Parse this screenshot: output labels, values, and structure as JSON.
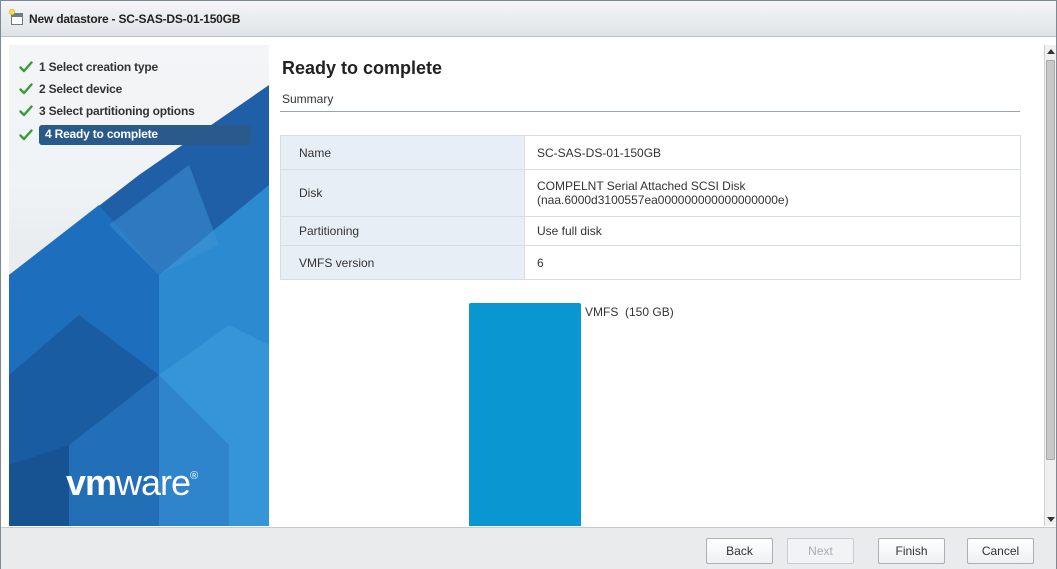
{
  "window": {
    "title": "New datastore - SC-SAS-DS-01-150GB"
  },
  "sidebar": {
    "steps": [
      {
        "label": "1 Select creation type",
        "state": "completed"
      },
      {
        "label": "2 Select device",
        "state": "completed"
      },
      {
        "label": "3 Select partitioning options",
        "state": "completed"
      },
      {
        "label": "4 Ready to complete",
        "state": "active"
      }
    ],
    "logo": {
      "prefix": "vm",
      "suffix": "ware",
      "mark": "®"
    },
    "colors": {
      "check": "#3a9a3a",
      "active_bg": "#2a5a8c"
    }
  },
  "main": {
    "title": "Ready to complete",
    "subtitle": "Summary",
    "summary": [
      {
        "key": "Name",
        "value": "SC-SAS-DS-01-150GB"
      },
      {
        "key": "Disk",
        "value": "COMPELNT Serial Attached SCSI Disk",
        "value2": "(naa.6000d3100557ea000000000000000000e)"
      },
      {
        "key": "Partitioning",
        "value": "Use full disk"
      },
      {
        "key": "VMFS version",
        "value": "6"
      }
    ],
    "partition_diagram": {
      "label": "VMFS  (150 GB)",
      "fill_fraction": 1.0,
      "color": "#0a96d0"
    }
  },
  "footer": {
    "back": "Back",
    "next": "Next",
    "finish": "Finish",
    "cancel": "Cancel"
  }
}
